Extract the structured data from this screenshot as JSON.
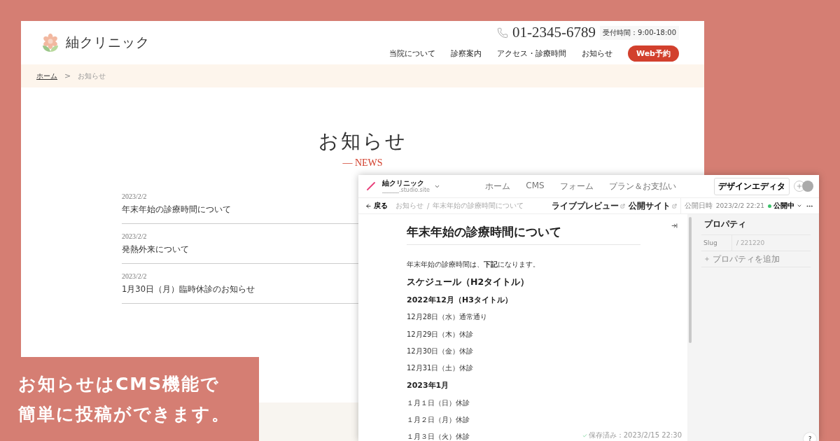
{
  "site": {
    "logo": "紬クリニック",
    "phone": "01-2345-6789",
    "hours": "受付時間：9:00-18:00",
    "nav": [
      "当院について",
      "診察案内",
      "アクセス・診療時間",
      "お知らせ"
    ],
    "reserve_button": "Web予約",
    "breadcrumb": [
      "ホーム",
      "お知らせ"
    ],
    "breadcrumb_separator": ">",
    "heading": "お知らせ",
    "subheading": "— NEWS",
    "news": [
      {
        "date": "2023/2/2",
        "title": "年末年始の診療時間について"
      },
      {
        "date": "2023/2/2",
        "title": "発熱外来について"
      },
      {
        "date": "2023/2/2",
        "title": "1月30日（月）臨時休診のお知らせ"
      }
    ]
  },
  "cms": {
    "site_name": "紬クリニック",
    "site_url": "______.studio.site",
    "nav": [
      "ホーム",
      "CMS",
      "フォーム",
      "プラン＆お支払い"
    ],
    "design_button": "デザインエディタ",
    "back": "戻る",
    "breadcrumb": [
      "お知らせ",
      "年末年始の診療時間について"
    ],
    "breadcrumb_separator": "/",
    "live_preview": "ライブプレビュー",
    "public_site": "公開サイト",
    "publish_label": "公開日時",
    "publish_date": "2023/2/2 22:21",
    "status": "公開中",
    "article": {
      "title": "年末年始の診療時間について",
      "blocks": [
        {
          "kind": "p",
          "text": "年末年始の診療時間は、**下記**になります。"
        },
        {
          "kind": "h2",
          "text": "スケジュール（H2タイトル）"
        },
        {
          "kind": "h3",
          "text": "2022年12月（H3タイトル）"
        },
        {
          "kind": "p",
          "text": "12月28日（水）通常通り"
        },
        {
          "kind": "p",
          "text": "12月29日（木）休診"
        },
        {
          "kind": "p",
          "text": "12月30日（金）休診"
        },
        {
          "kind": "p",
          "text": "12月31日（土）休診"
        },
        {
          "kind": "h3",
          "text": "2023年1月"
        },
        {
          "kind": "p",
          "text": "１月１日（日）休診"
        },
        {
          "kind": "p",
          "text": "１月２日（月）休診"
        },
        {
          "kind": "p",
          "text": "１月３日（火）休診"
        }
      ]
    },
    "saved": "保存済み：2023/2/15 22:30",
    "properties": {
      "title": "プロパティ",
      "rows": [
        {
          "label": "Slug",
          "value": "/ 221220"
        }
      ],
      "add": "プロパティを追加"
    },
    "help": "?"
  },
  "caption": [
    "お知らせはCMS機能で",
    "簡単に投稿ができます。"
  ]
}
